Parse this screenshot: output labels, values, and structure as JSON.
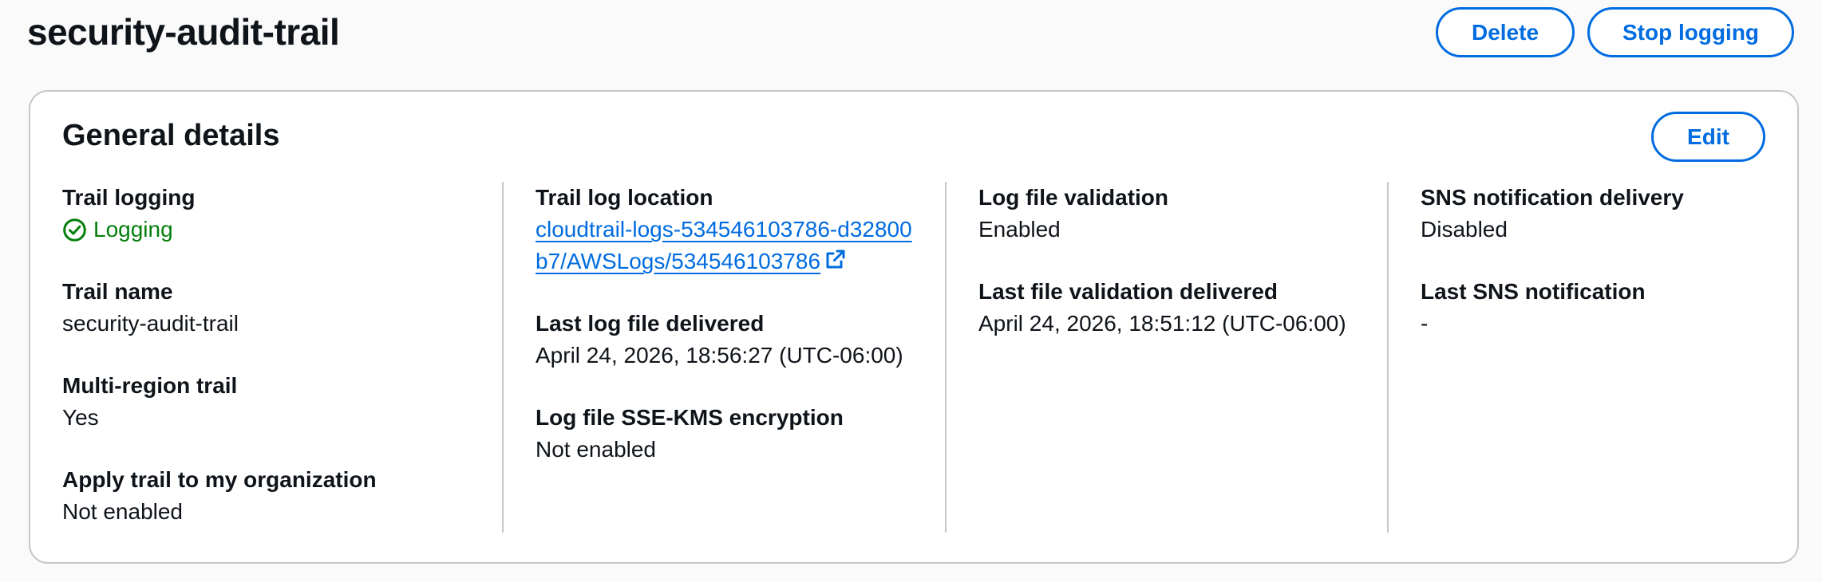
{
  "page": {
    "title": "security-audit-trail"
  },
  "header_actions": {
    "delete_label": "Delete",
    "stop_logging_label": "Stop logging"
  },
  "general_details": {
    "title": "General details",
    "edit_label": "Edit",
    "columns": [
      {
        "fields": [
          {
            "label": "Trail logging",
            "value": "Logging",
            "status": "success",
            "icon": "check-circle-icon"
          },
          {
            "label": "Trail name",
            "value": "security-audit-trail"
          },
          {
            "label": "Multi-region trail",
            "value": "Yes"
          },
          {
            "label": "Apply trail to my organization",
            "value": "Not enabled"
          }
        ]
      },
      {
        "fields": [
          {
            "label": "Trail log location",
            "value": "cloudtrail-logs-534546103786-d32800b7/AWSLogs/534546103786",
            "icon": "external-link-icon"
          },
          {
            "label": "Last log file delivered",
            "value": "April 24, 2026, 18:56:27 (UTC-06:00)"
          },
          {
            "label": "Log file SSE-KMS encryption",
            "value": "Not enabled"
          }
        ]
      },
      {
        "fields": [
          {
            "label": "Log file validation",
            "value": "Enabled"
          },
          {
            "label": "Last file validation delivered",
            "value": "April 24, 2026, 18:51:12 (UTC-06:00)"
          }
        ]
      },
      {
        "fields": [
          {
            "label": "SNS notification delivery",
            "value": "Disabled"
          },
          {
            "label": "Last SNS notification",
            "value": "-"
          }
        ]
      }
    ]
  },
  "colors": {
    "accent": "#006ce0",
    "success": "#037f0c",
    "border": "#c6c6cd",
    "text": "#0f141a"
  }
}
